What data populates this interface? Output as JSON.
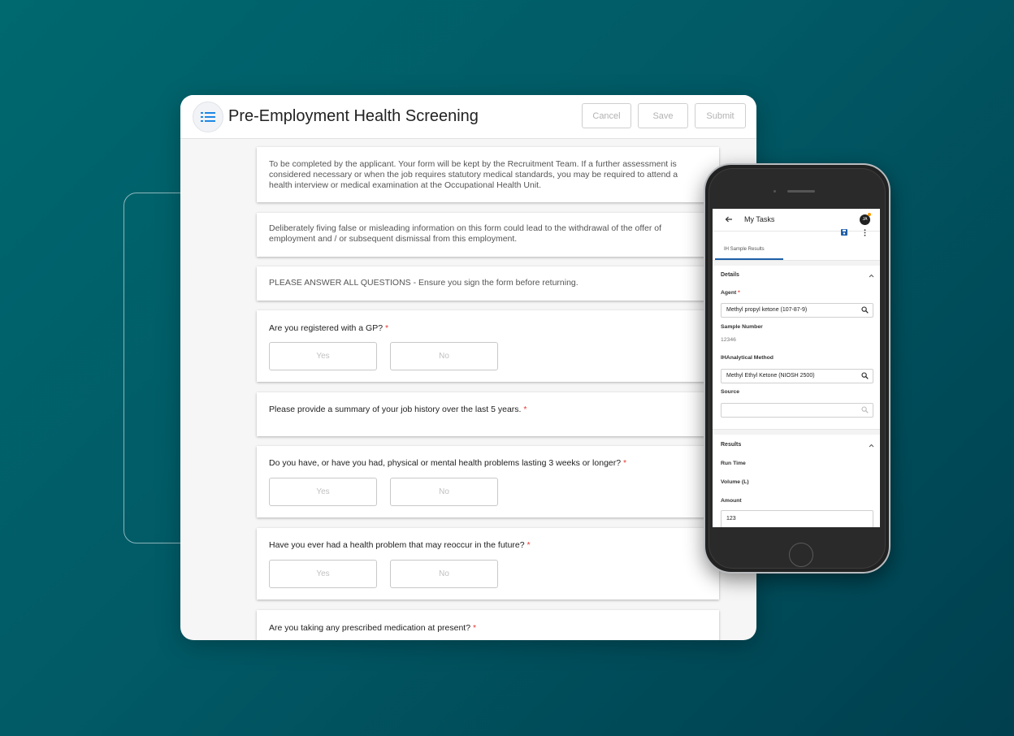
{
  "form": {
    "title": "Pre-Employment Health Screening",
    "buttons": {
      "cancel": "Cancel",
      "save": "Save",
      "submit": "Submit"
    },
    "intro": "To be completed by the applicant. Your form will be kept by the Recruitment Team. If a further assessment is considered necessary or when the job requires statutory medical standards, you may be required to attend a health interview or medical examination at the Occupational Health Unit.",
    "warning": "Deliberately fiving false or misleading information on this form could lead to the withdrawal of the offer of employment and / or subsequent dismissal from this employment.",
    "instruction": "PLEASE ANSWER ALL QUESTIONS - Ensure you sign the form before returning.",
    "required_mark": "*",
    "yes_label": "Yes",
    "no_label": "No",
    "q_gp": "Are you registered with a GP?",
    "q_job_history": "Please provide a summary of your job history over the last 5 years.",
    "q_health_problems": "Do you have, or have you had, physical or mental health problems lasting 3 weeks or longer?",
    "q_reoccur": "Have you ever had a health problem that may reoccur in the future?",
    "q_medication": "Are you taking any prescribed medication at present?"
  },
  "mobile": {
    "title": "My Tasks",
    "avatar_initials": "JA",
    "tab": "IH Sample Results",
    "details": {
      "title": "Details",
      "agent_label": "Agent",
      "agent_value": "Methyl propyl ketone (107-87-9)",
      "sample_number_label": "Sample Number",
      "sample_number_value": "12346",
      "method_label": "IHAnalytical Method",
      "method_value": "Methyl Ethyl Ketone (NIOSH 2500)",
      "source_label": "Source",
      "source_value": ""
    },
    "results": {
      "title": "Results",
      "run_time_label": "Run Time",
      "volume_label": "Volume (L)",
      "amount_label": "Amount",
      "amount_value": "123"
    }
  },
  "colors": {
    "accent": "#1e88e5",
    "required": "#e53935",
    "background": "#015a66"
  }
}
